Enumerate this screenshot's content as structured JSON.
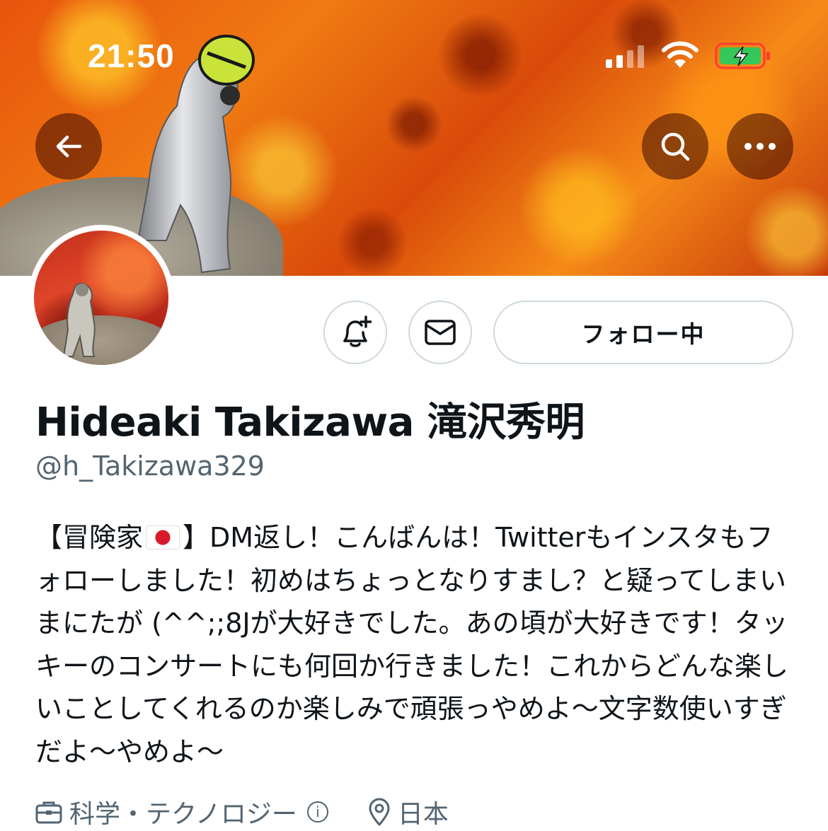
{
  "status_bar": {
    "time": "21:50",
    "icons": [
      "cellular-signal-icon",
      "wifi-icon",
      "battery-charging-icon"
    ]
  },
  "header": {
    "back_icon": "arrow-left-icon",
    "search_icon": "search-icon",
    "more_icon": "more-horizontal-icon"
  },
  "profile": {
    "display_name": "Hideaki Takizawa 滝沢秀明",
    "handle": "@h_Takizawa329",
    "follow_button_label": "フォロー中",
    "notify_icon": "bell-plus-icon",
    "dm_icon": "mail-icon",
    "bio_before_flag": "【冒険家",
    "bio_after_flag": "】DM返し！こんばんは！Twitterもインスタもフォローしました！初めはちょっとなりすまし？と疑ってしまいまにたが (^^;;8Jが大好きでした。あの頃が大好きです！タッキーのコンサートにも何回か行きました！これからどんな楽しいことしてくれるのか楽しみで頑張っやめよ〜文字数使いすぎだよ〜やめよ〜",
    "category_label": "科学・テクノロジー",
    "location_label": "日本"
  },
  "colors": {
    "text_primary": "#0f1419",
    "text_secondary": "#536471",
    "border": "#cfd9de",
    "battery_green": "#34c759",
    "battery_outline": "#ff3b30"
  }
}
